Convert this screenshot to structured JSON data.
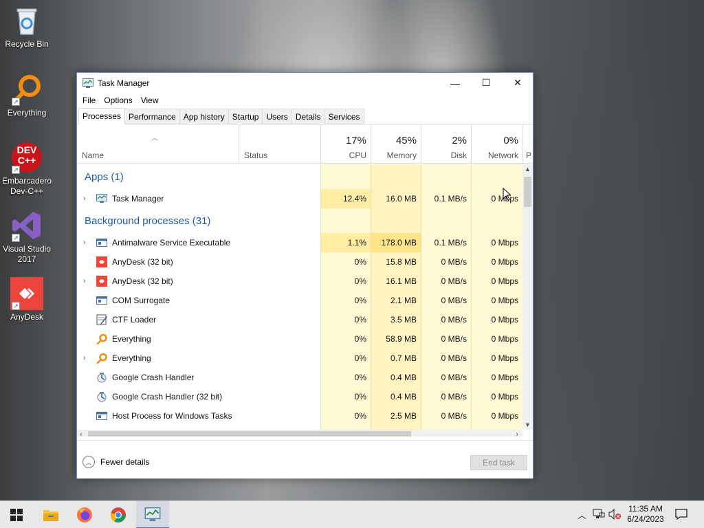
{
  "desktop": {
    "icons": [
      {
        "label": "Recycle Bin",
        "icon": "recycle-bin-icon"
      },
      {
        "label": "Everything",
        "icon": "everything-icon"
      },
      {
        "label": "Embarcadero Dev-C++",
        "icon": "devcpp-icon",
        "badge_top": "DEV",
        "badge_bottom": "C++"
      },
      {
        "label": "Visual Studio 2017",
        "icon": "visual-studio-icon"
      },
      {
        "label": "AnyDesk",
        "icon": "anydesk-icon"
      }
    ]
  },
  "window": {
    "title": "Task Manager",
    "controls": {
      "minimize": "—",
      "maximize": "☐",
      "close": "✕"
    },
    "menu": [
      "File",
      "Options",
      "View"
    ],
    "tabs": [
      "Processes",
      "Performance",
      "App history",
      "Startup",
      "Users",
      "Details",
      "Services"
    ],
    "active_tab": "Processes",
    "columns": {
      "name": "Name",
      "status": "Status",
      "cpu": {
        "pct": "17%",
        "label": "CPU"
      },
      "memory": {
        "pct": "45%",
        "label": "Memory"
      },
      "disk": {
        "pct": "2%",
        "label": "Disk"
      },
      "network": {
        "pct": "0%",
        "label": "Network"
      },
      "power_partial": "P"
    },
    "groups": {
      "apps": "Apps (1)",
      "background": "Background processes (31)"
    },
    "apps": [
      {
        "name": "Task Manager",
        "expandable": true,
        "cpu": "12.4%",
        "mem": "16.0 MB",
        "disk": "0.1 MB/s",
        "net": "0 Mbps",
        "icon": "task-manager-icon"
      }
    ],
    "background": [
      {
        "name": "Antimalware Service Executable",
        "expandable": true,
        "cpu": "1.1%",
        "mem": "178.0 MB",
        "disk": "0.1 MB/s",
        "net": "0 Mbps",
        "icon": "service-icon"
      },
      {
        "name": "AnyDesk (32 bit)",
        "expandable": false,
        "cpu": "0%",
        "mem": "15.8 MB",
        "disk": "0 MB/s",
        "net": "0 Mbps",
        "icon": "anydesk-icon"
      },
      {
        "name": "AnyDesk (32 bit)",
        "expandable": true,
        "cpu": "0%",
        "mem": "16.1 MB",
        "disk": "0 MB/s",
        "net": "0 Mbps",
        "icon": "anydesk-icon"
      },
      {
        "name": "COM Surrogate",
        "expandable": false,
        "cpu": "0%",
        "mem": "2.1 MB",
        "disk": "0 MB/s",
        "net": "0 Mbps",
        "icon": "service-icon"
      },
      {
        "name": "CTF Loader",
        "expandable": false,
        "cpu": "0%",
        "mem": "3.5 MB",
        "disk": "0 MB/s",
        "net": "0 Mbps",
        "icon": "ctf-loader-icon"
      },
      {
        "name": "Everything",
        "expandable": false,
        "cpu": "0%",
        "mem": "58.9 MB",
        "disk": "0 MB/s",
        "net": "0 Mbps",
        "icon": "everything-icon"
      },
      {
        "name": "Everything",
        "expandable": true,
        "cpu": "0%",
        "mem": "0.7 MB",
        "disk": "0 MB/s",
        "net": "0 Mbps",
        "icon": "everything-icon"
      },
      {
        "name": "Google Crash Handler",
        "expandable": false,
        "cpu": "0%",
        "mem": "0.4 MB",
        "disk": "0 MB/s",
        "net": "0 Mbps",
        "icon": "google-crash-icon"
      },
      {
        "name": "Google Crash Handler (32 bit)",
        "expandable": false,
        "cpu": "0%",
        "mem": "0.4 MB",
        "disk": "0 MB/s",
        "net": "0 Mbps",
        "icon": "google-crash-icon"
      },
      {
        "name": "Host Process for Windows Tasks",
        "expandable": false,
        "cpu": "0%",
        "mem": "2.5 MB",
        "disk": "0 MB/s",
        "net": "0 Mbps",
        "icon": "service-icon"
      }
    ],
    "footer": {
      "fewer_details": "Fewer details",
      "end_task": "End task"
    }
  },
  "taskbar": {
    "items": [
      "start-icon",
      "file-explorer-icon",
      "firefox-icon",
      "chrome-icon",
      "task-manager-icon"
    ],
    "clock_time": "11:35 AM",
    "clock_date": "6/24/2023"
  },
  "colors": {
    "group_header": "#1f5ba8",
    "cpu_heat": "#fff2b3",
    "heat_light": "#fff8d5",
    "heat_mid": "#ffefb0",
    "accent": "#3a78d4"
  }
}
